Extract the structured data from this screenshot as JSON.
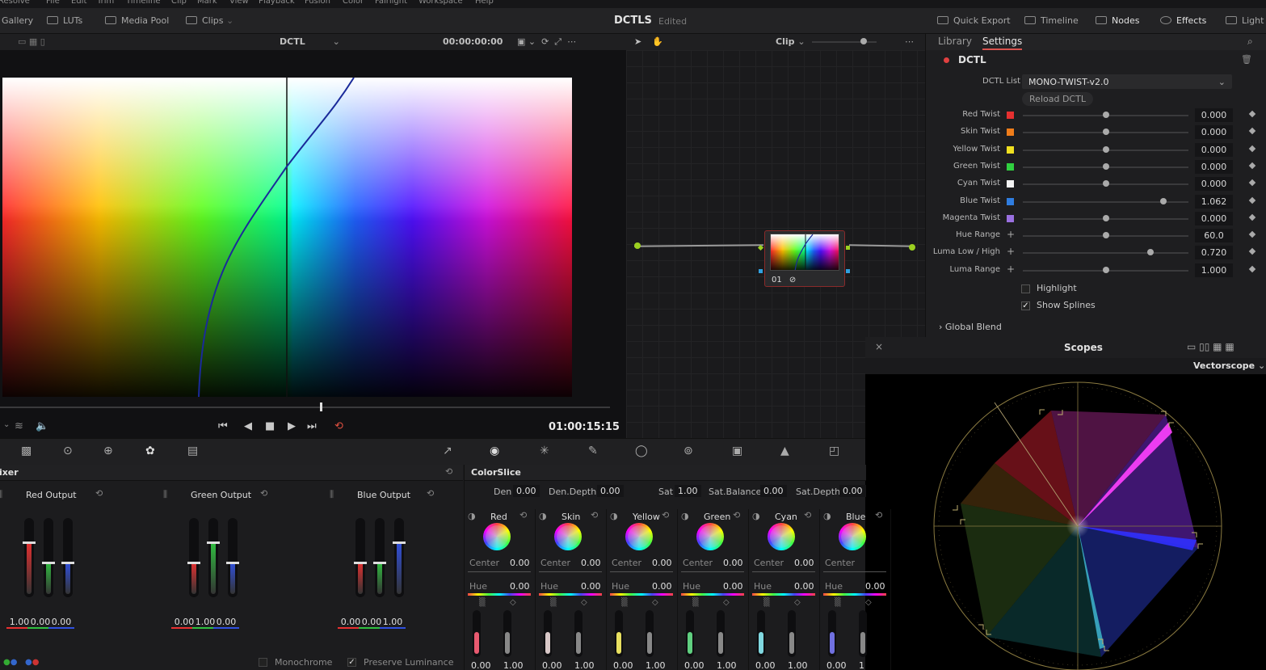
{
  "menubar": [
    "Resolve",
    "File",
    "Edit",
    "Trim",
    "Timeline",
    "Clip",
    "Mark",
    "View",
    "Playback",
    "Fusion",
    "Color",
    "Fairlight",
    "Workspace",
    "Help"
  ],
  "toolbar": {
    "gallery": "Gallery",
    "luts": "LUTs",
    "media_pool": "Media Pool",
    "clips": "Clips",
    "project_title": "DCTLS",
    "project_status": "Edited",
    "quick_export": "Quick Export",
    "timeline": "Timeline",
    "nodes": "Nodes",
    "effects": "Effects",
    "light": "Light"
  },
  "viewer": {
    "mode": "DCTL",
    "timecode_in": "00:00:00:00",
    "clip_label": "Clip",
    "timecode": "01:00:15:15"
  },
  "node": {
    "label": "01"
  },
  "settings": {
    "tabs": [
      "Library",
      "Settings"
    ],
    "section": "DCTL",
    "dctl_list_label": "DCTL List",
    "dctl_list_value": "MONO-TWIST-v2.0",
    "reload_button": "Reload DCTL",
    "params": [
      {
        "label": "Red Twist",
        "color": "#e53030",
        "value": "0.000",
        "level": 0.5
      },
      {
        "label": "Skin Twist",
        "color": "#f07d1a",
        "value": "0.000",
        "level": 0.5
      },
      {
        "label": "Yellow Twist",
        "color": "#f0e020",
        "value": "0.000",
        "level": 0.5
      },
      {
        "label": "Green Twist",
        "color": "#30d040",
        "value": "0.000",
        "level": 0.5
      },
      {
        "label": "Cyan Twist",
        "color": "#f4f4f4",
        "value": "0.000",
        "level": 0.5
      },
      {
        "label": "Blue Twist",
        "color": "#2f7de0",
        "value": "1.062",
        "level": 0.85
      },
      {
        "label": "Magenta Twist",
        "color": "#9a70e0",
        "value": "0.000",
        "level": 0.5
      },
      {
        "label": "Hue Range",
        "color": "",
        "value": "60.0",
        "level": 0.5
      },
      {
        "label": "Luma Low / High",
        "color": "",
        "value": "0.720",
        "level": 0.77
      },
      {
        "label": "Luma Range",
        "color": "",
        "value": "1.000",
        "level": 0.5
      }
    ],
    "highlight_label": "Highlight",
    "show_splines_label": "Show Splines",
    "global_blend": "Global Blend"
  },
  "scopes": {
    "title": "Scopes",
    "mode": "Vectorscope"
  },
  "mixer": {
    "title": "Mixer",
    "outputs": [
      {
        "label": "Red Output",
        "values": [
          "1.00",
          "0.00",
          "0.00"
        ],
        "levels": [
          0.72,
          0.45,
          0.45
        ]
      },
      {
        "label": "Green Output",
        "values": [
          "0.00",
          "1.00",
          "0.00"
        ],
        "levels": [
          0.45,
          0.72,
          0.45
        ]
      },
      {
        "label": "Blue Output",
        "values": [
          "0.00",
          "0.00",
          "1.00"
        ],
        "levels": [
          0.45,
          0.45,
          0.72
        ]
      }
    ],
    "monochrome": "Monochrome",
    "preserve_luminance": "Preserve Luminance"
  },
  "colorslice": {
    "title": "ColorSlice",
    "den_label": "Den",
    "den": "0.00",
    "den_depth_label": "Den.Depth",
    "den_depth": "0.00",
    "sat_label": "Sat",
    "sat": "1.00",
    "sat_balance_label": "Sat.Balance",
    "sat_balance": "0.00",
    "sat_depth_label": "Sat.Depth",
    "sat_depth": "0.00",
    "center_label": "Center",
    "hue_label": "Hue",
    "slices": [
      {
        "name": "Red",
        "center": "0.00",
        "hue": "0.00",
        "v1": "0.00",
        "v2": "1.00",
        "color": "#e85a70"
      },
      {
        "name": "Skin",
        "center": "0.00",
        "hue": "0.00",
        "v1": "0.00",
        "v2": "1.00",
        "color": "#d8c8c8"
      },
      {
        "name": "Yellow",
        "center": "0.00",
        "hue": "0.00",
        "v1": "0.00",
        "v2": "1.00",
        "color": "#e8e060"
      },
      {
        "name": "Green",
        "center": "0.00",
        "hue": "0.00",
        "v1": "0.00",
        "v2": "1.00",
        "color": "#60d080"
      },
      {
        "name": "Cyan",
        "center": "0.00",
        "hue": "0.00",
        "v1": "0.00",
        "v2": "1.00",
        "color": "#80d8e0"
      },
      {
        "name": "Blue",
        "center": "",
        "hue": "0.00",
        "v1": "0.00",
        "v2": "1",
        "color": "#7070e0"
      }
    ]
  }
}
